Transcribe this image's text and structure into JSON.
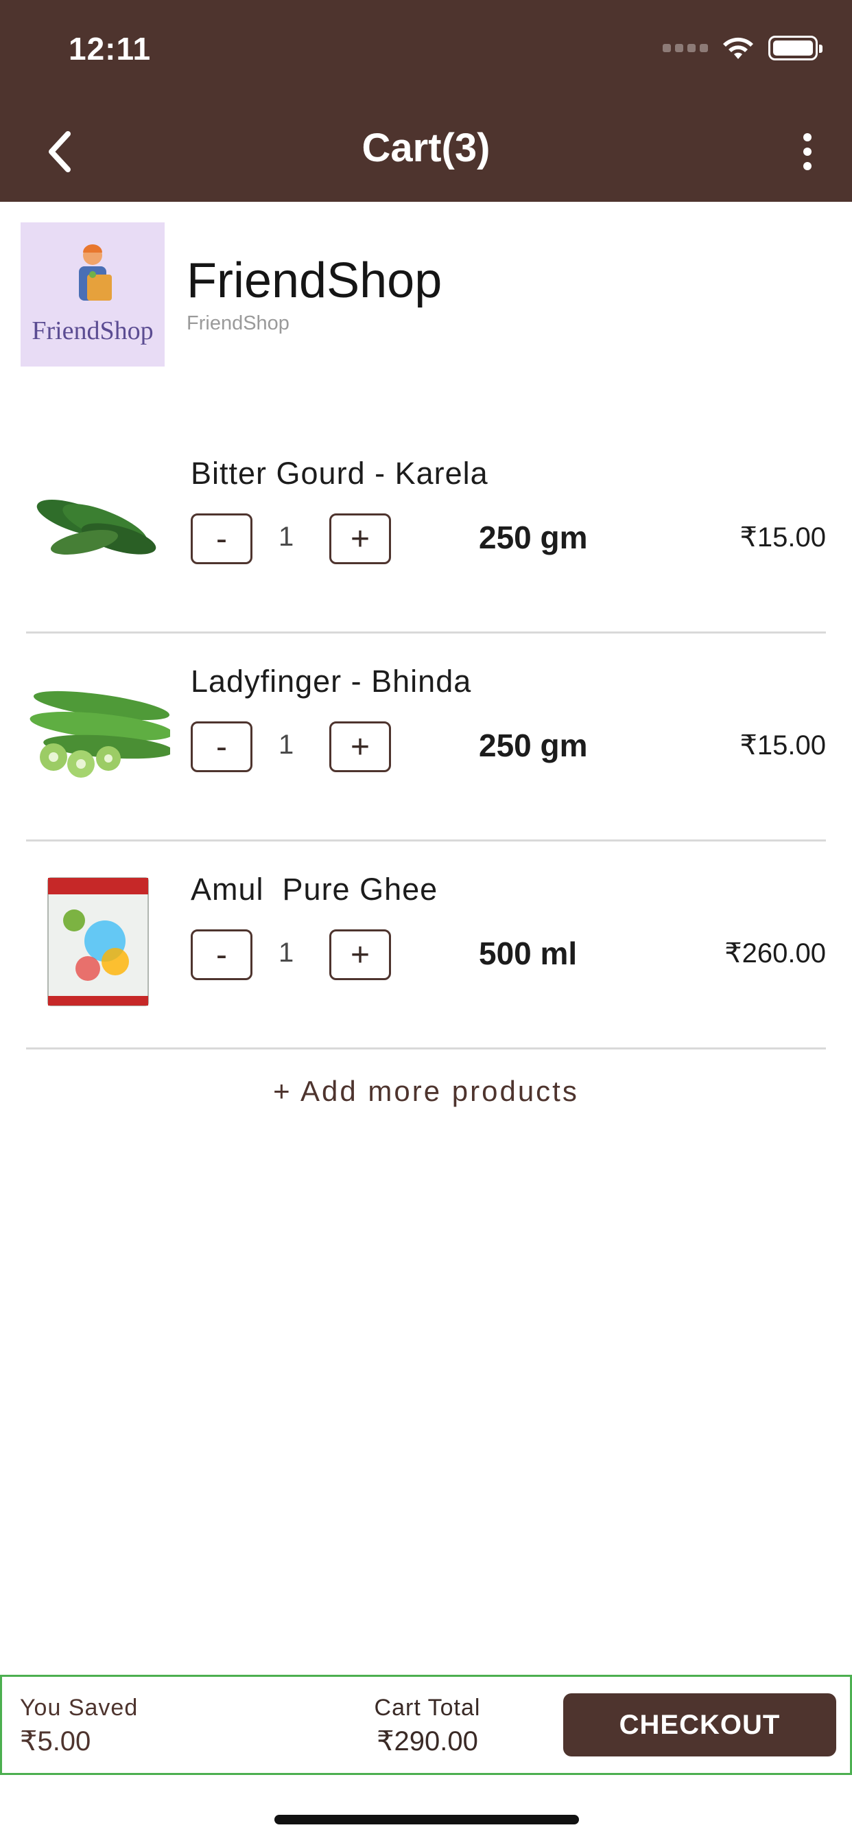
{
  "status_bar": {
    "time": "12:11"
  },
  "nav": {
    "title": "Cart(3)"
  },
  "shop": {
    "name": "FriendShop",
    "subtitle": "FriendShop",
    "logo_text": "FriendShop"
  },
  "items": [
    {
      "name": "Bitter Gourd - Karela",
      "quantity": "1",
      "unit": "250 gm",
      "price": "₹15.00",
      "minus": "-",
      "plus": "+"
    },
    {
      "name": "Ladyfinger - Bhinda",
      "quantity": "1",
      "unit": "250 gm",
      "price": "₹15.00",
      "minus": "-",
      "plus": "+"
    },
    {
      "name": "Amul  Pure Ghee",
      "quantity": "1",
      "unit": "500 ml",
      "price": "₹260.00",
      "minus": "-",
      "plus": "+"
    }
  ],
  "add_more": "+ Add more products",
  "summary": {
    "saved_label": "You Saved",
    "saved_value": "₹5.00",
    "total_label": "Cart Total",
    "total_value": "₹290.00",
    "checkout_label": "CHECKOUT"
  },
  "colors": {
    "brand": "#4e342e",
    "bar_border": "#4caf50",
    "logo_bg": "#e8dcf5"
  }
}
